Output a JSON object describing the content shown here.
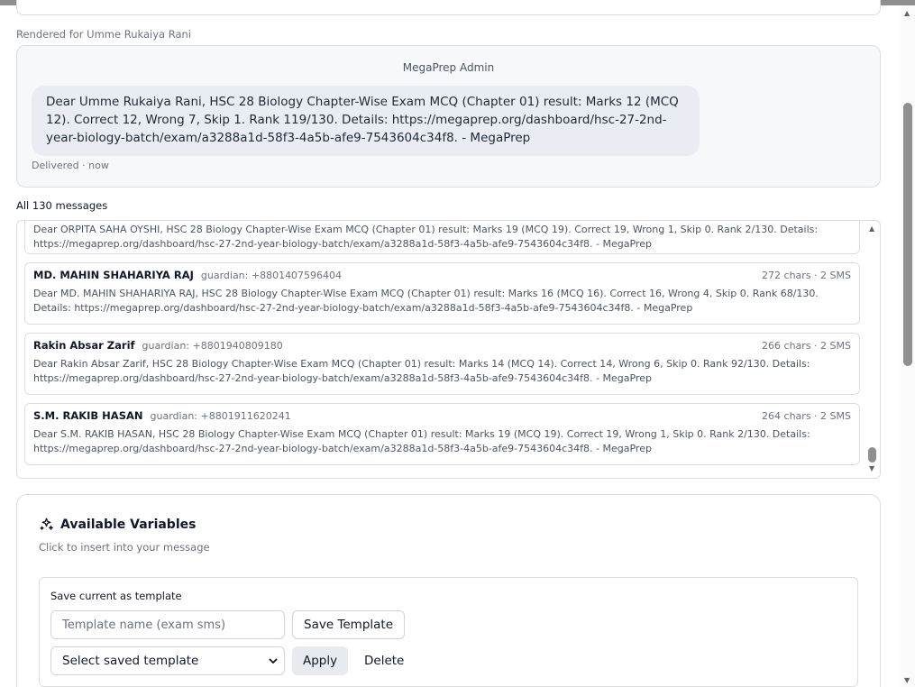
{
  "preview": {
    "rendered_for": "Rendered for Umme Rukaiya Rani",
    "sender": "MegaPrep Admin",
    "message": "Dear Umme Rukaiya Rani, HSC 28 Biology Chapter-Wise Exam MCQ (Chapter 01) result: Marks 12 (MCQ 12). Correct 12, Wrong 7, Skip 1. Rank 119/130. Details: https://megaprep.org/dashboard/hsc-27-2nd-year-biology-batch/exam/a3288a1d-58f3-4a5b-afe9-7543604c34f8. - MegaPrep",
    "status": "Delivered · now"
  },
  "messages": {
    "heading": "All 130 messages",
    "items": [
      {
        "name": "",
        "guardian": "",
        "meta": "",
        "body": "Dear ORPITA SAHA OYSHI, HSC 28 Biology Chapter-Wise Exam MCQ (Chapter 01) result: Marks 19 (MCQ 19). Correct 19, Wrong 1, Skip 0. Rank 2/130. Details: https://megaprep.org/dashboard/hsc-27-2nd-year-biology-batch/exam/a3288a1d-58f3-4a5b-afe9-7543604c34f8. - MegaPrep"
      },
      {
        "name": "MD. MAHIN SHAHARIYA RAJ",
        "guardian": "guardian: +8801407596404",
        "meta": "272 chars · 2 SMS",
        "body": "Dear MD. MAHIN SHAHARIYA RAJ, HSC 28 Biology Chapter-Wise Exam MCQ (Chapter 01) result: Marks 16 (MCQ 16). Correct 16, Wrong 4, Skip 0. Rank 68/130. Details: https://megaprep.org/dashboard/hsc-27-2nd-year-biology-batch/exam/a3288a1d-58f3-4a5b-afe9-7543604c34f8. - MegaPrep"
      },
      {
        "name": "Rakin Absar Zarif",
        "guardian": "guardian: +8801940809180",
        "meta": "266 chars · 2 SMS",
        "body": "Dear Rakin Absar Zarif, HSC 28 Biology Chapter-Wise Exam MCQ (Chapter 01) result: Marks 14 (MCQ 14). Correct 14, Wrong 6, Skip 0. Rank 92/130. Details: https://megaprep.org/dashboard/hsc-27-2nd-year-biology-batch/exam/a3288a1d-58f3-4a5b-afe9-7543604c34f8. - MegaPrep"
      },
      {
        "name": "S.M. RAKIB HASAN",
        "guardian": "guardian: +8801911620241",
        "meta": "264 chars · 2 SMS",
        "body": "Dear S.M. RAKIB HASAN, HSC 28 Biology Chapter-Wise Exam MCQ (Chapter 01) result: Marks 19 (MCQ 19). Correct 19, Wrong 1, Skip 0. Rank 2/130. Details: https://megaprep.org/dashboard/hsc-27-2nd-year-biology-batch/exam/a3288a1d-58f3-4a5b-afe9-7543604c34f8. - MegaPrep"
      }
    ]
  },
  "variables": {
    "title": "Available Variables",
    "subtitle": "Click to insert into your message",
    "icon": "sparkles-icon"
  },
  "template": {
    "label": "Save current as template",
    "name_placeholder": "Template name (exam sms)",
    "save_label": "Save Template",
    "select_value": "Select saved template",
    "apply_label": "Apply",
    "delete_label": "Delete"
  }
}
